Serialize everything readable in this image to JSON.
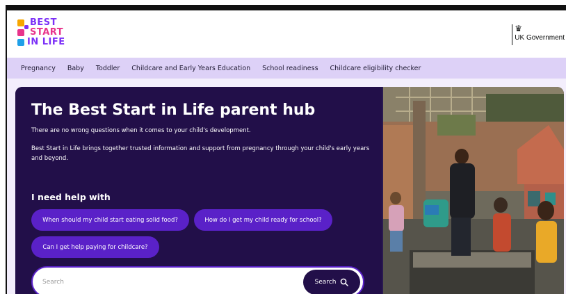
{
  "brand": {
    "logo_lines": [
      "BEST",
      "START",
      "IN LIFE"
    ],
    "logo_colors": [
      "#7b2ff7",
      "#e8338b",
      "#7b2ff7"
    ],
    "square_colors": [
      "#f7a600",
      "#e8338b",
      "#1fa0e8",
      "#7b2ff7"
    ],
    "gov_name": "UK Government"
  },
  "nav": {
    "items": [
      "Pregnancy",
      "Baby",
      "Toddler",
      "Childcare and Early Years Education",
      "School readiness",
      "Childcare eligibility checker"
    ]
  },
  "hero": {
    "title": "The Best Start in Life parent hub",
    "subtitle": "There are no wrong questions when it comes to your child's development.",
    "description": "Best Start in Life brings together trusted information and support from pregnancy through your child's early years and beyond.",
    "help_title": "I need help with",
    "quick_links": [
      "When should my child start eating solid food?",
      "How do I get my child ready for school?",
      "Can I get help paying for childcare?"
    ],
    "photo_icon": "family-playground-photo"
  },
  "search": {
    "placeholder": "Search",
    "button_label": "Search",
    "button_icon": "search-icon"
  },
  "colors": {
    "hero_bg": "#220f49",
    "pill": "#5a21c8",
    "nav_bg": "#ddd1f7"
  }
}
